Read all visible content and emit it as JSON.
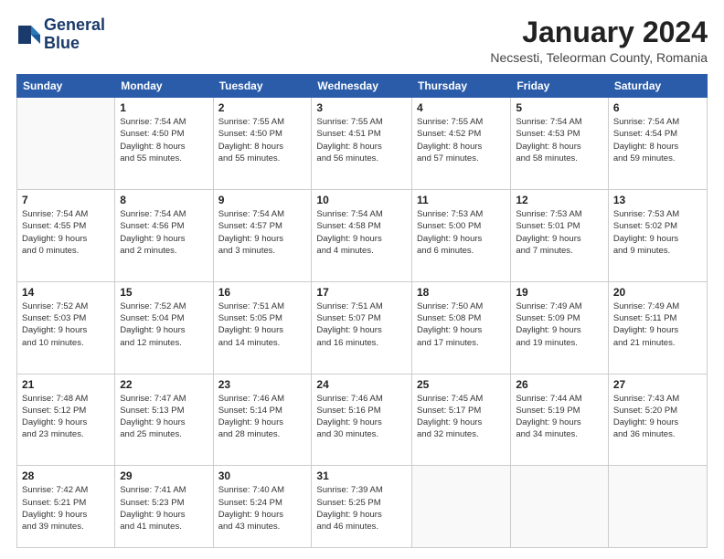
{
  "header": {
    "logo_line1": "General",
    "logo_line2": "Blue",
    "month_title": "January 2024",
    "location": "Necsesti, Teleorman County, Romania"
  },
  "days_of_week": [
    "Sunday",
    "Monday",
    "Tuesday",
    "Wednesday",
    "Thursday",
    "Friday",
    "Saturday"
  ],
  "weeks": [
    [
      {
        "day": "",
        "info": ""
      },
      {
        "day": "1",
        "info": "Sunrise: 7:54 AM\nSunset: 4:50 PM\nDaylight: 8 hours\nand 55 minutes."
      },
      {
        "day": "2",
        "info": "Sunrise: 7:55 AM\nSunset: 4:50 PM\nDaylight: 8 hours\nand 55 minutes."
      },
      {
        "day": "3",
        "info": "Sunrise: 7:55 AM\nSunset: 4:51 PM\nDaylight: 8 hours\nand 56 minutes."
      },
      {
        "day": "4",
        "info": "Sunrise: 7:55 AM\nSunset: 4:52 PM\nDaylight: 8 hours\nand 57 minutes."
      },
      {
        "day": "5",
        "info": "Sunrise: 7:54 AM\nSunset: 4:53 PM\nDaylight: 8 hours\nand 58 minutes."
      },
      {
        "day": "6",
        "info": "Sunrise: 7:54 AM\nSunset: 4:54 PM\nDaylight: 8 hours\nand 59 minutes."
      }
    ],
    [
      {
        "day": "7",
        "info": "Sunrise: 7:54 AM\nSunset: 4:55 PM\nDaylight: 9 hours\nand 0 minutes."
      },
      {
        "day": "8",
        "info": "Sunrise: 7:54 AM\nSunset: 4:56 PM\nDaylight: 9 hours\nand 2 minutes."
      },
      {
        "day": "9",
        "info": "Sunrise: 7:54 AM\nSunset: 4:57 PM\nDaylight: 9 hours\nand 3 minutes."
      },
      {
        "day": "10",
        "info": "Sunrise: 7:54 AM\nSunset: 4:58 PM\nDaylight: 9 hours\nand 4 minutes."
      },
      {
        "day": "11",
        "info": "Sunrise: 7:53 AM\nSunset: 5:00 PM\nDaylight: 9 hours\nand 6 minutes."
      },
      {
        "day": "12",
        "info": "Sunrise: 7:53 AM\nSunset: 5:01 PM\nDaylight: 9 hours\nand 7 minutes."
      },
      {
        "day": "13",
        "info": "Sunrise: 7:53 AM\nSunset: 5:02 PM\nDaylight: 9 hours\nand 9 minutes."
      }
    ],
    [
      {
        "day": "14",
        "info": "Sunrise: 7:52 AM\nSunset: 5:03 PM\nDaylight: 9 hours\nand 10 minutes."
      },
      {
        "day": "15",
        "info": "Sunrise: 7:52 AM\nSunset: 5:04 PM\nDaylight: 9 hours\nand 12 minutes."
      },
      {
        "day": "16",
        "info": "Sunrise: 7:51 AM\nSunset: 5:05 PM\nDaylight: 9 hours\nand 14 minutes."
      },
      {
        "day": "17",
        "info": "Sunrise: 7:51 AM\nSunset: 5:07 PM\nDaylight: 9 hours\nand 16 minutes."
      },
      {
        "day": "18",
        "info": "Sunrise: 7:50 AM\nSunset: 5:08 PM\nDaylight: 9 hours\nand 17 minutes."
      },
      {
        "day": "19",
        "info": "Sunrise: 7:49 AM\nSunset: 5:09 PM\nDaylight: 9 hours\nand 19 minutes."
      },
      {
        "day": "20",
        "info": "Sunrise: 7:49 AM\nSunset: 5:11 PM\nDaylight: 9 hours\nand 21 minutes."
      }
    ],
    [
      {
        "day": "21",
        "info": "Sunrise: 7:48 AM\nSunset: 5:12 PM\nDaylight: 9 hours\nand 23 minutes."
      },
      {
        "day": "22",
        "info": "Sunrise: 7:47 AM\nSunset: 5:13 PM\nDaylight: 9 hours\nand 25 minutes."
      },
      {
        "day": "23",
        "info": "Sunrise: 7:46 AM\nSunset: 5:14 PM\nDaylight: 9 hours\nand 28 minutes."
      },
      {
        "day": "24",
        "info": "Sunrise: 7:46 AM\nSunset: 5:16 PM\nDaylight: 9 hours\nand 30 minutes."
      },
      {
        "day": "25",
        "info": "Sunrise: 7:45 AM\nSunset: 5:17 PM\nDaylight: 9 hours\nand 32 minutes."
      },
      {
        "day": "26",
        "info": "Sunrise: 7:44 AM\nSunset: 5:19 PM\nDaylight: 9 hours\nand 34 minutes."
      },
      {
        "day": "27",
        "info": "Sunrise: 7:43 AM\nSunset: 5:20 PM\nDaylight: 9 hours\nand 36 minutes."
      }
    ],
    [
      {
        "day": "28",
        "info": "Sunrise: 7:42 AM\nSunset: 5:21 PM\nDaylight: 9 hours\nand 39 minutes."
      },
      {
        "day": "29",
        "info": "Sunrise: 7:41 AM\nSunset: 5:23 PM\nDaylight: 9 hours\nand 41 minutes."
      },
      {
        "day": "30",
        "info": "Sunrise: 7:40 AM\nSunset: 5:24 PM\nDaylight: 9 hours\nand 43 minutes."
      },
      {
        "day": "31",
        "info": "Sunrise: 7:39 AM\nSunset: 5:25 PM\nDaylight: 9 hours\nand 46 minutes."
      },
      {
        "day": "",
        "info": ""
      },
      {
        "day": "",
        "info": ""
      },
      {
        "day": "",
        "info": ""
      }
    ]
  ]
}
